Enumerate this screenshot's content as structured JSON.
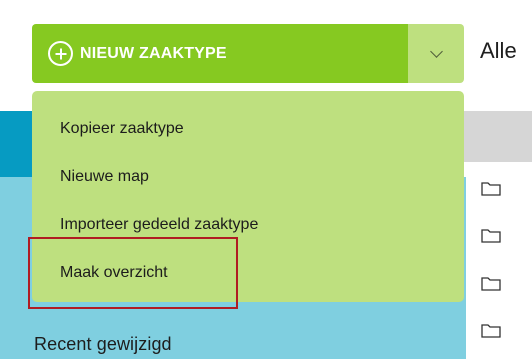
{
  "header": {
    "new_button_label": "NIEUW ZAAKTYPE",
    "filter_text": "Alle"
  },
  "dropdown": {
    "items": [
      {
        "label": "Kopieer zaaktype"
      },
      {
        "label": "Nieuwe map"
      },
      {
        "label": "Importeer gedeeld zaaktype"
      },
      {
        "label": "Maak overzicht"
      }
    ],
    "highlighted_item": "Maak overzicht"
  },
  "sidebar": {
    "recent_label": "Recent gewijzigd"
  },
  "icons": {
    "new": "plus-circle-icon",
    "toggle": "chevron-down-icon",
    "rows": "folder-icon"
  },
  "colors": {
    "primary_green": "#86c921",
    "light_green": "#bee07f",
    "blue_dark": "#069bc2",
    "blue_light": "#7fcfe0",
    "highlight_red": "#b01c22"
  }
}
